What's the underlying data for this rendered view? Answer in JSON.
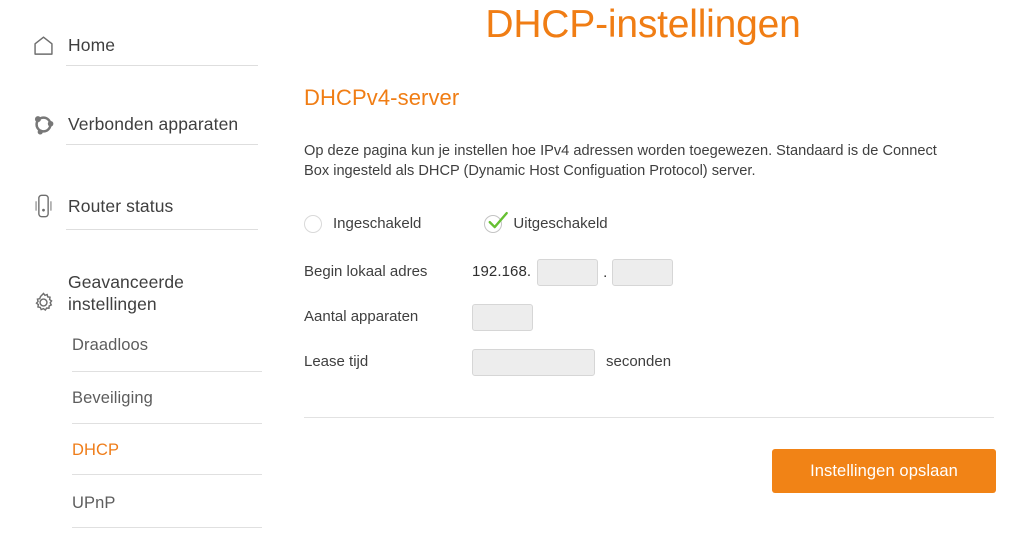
{
  "header": {
    "title": "DHCP-instellingen",
    "accent_color": "#f07d14"
  },
  "sidebar": {
    "main_items": [
      {
        "label": "Home",
        "icon": "home-icon",
        "active": false
      },
      {
        "label": "Verbonden apparaten",
        "icon": "connected-devices-icon",
        "active": false
      },
      {
        "label": "Router status",
        "icon": "router-icon",
        "active": false
      },
      {
        "label": "Geavanceerde instellingen",
        "icon": "gear-icon",
        "active": false
      }
    ],
    "sub_items": [
      {
        "label": "Draadloos",
        "active": false
      },
      {
        "label": "Beveiliging",
        "active": false
      },
      {
        "label": "DHCP",
        "active": true
      },
      {
        "label": "UPnP",
        "active": false
      }
    ],
    "active_color": "#ef7d1a"
  },
  "main": {
    "section_title": "DHCPv4-server",
    "intro_text": "Op deze pagina kun je instellen hoe IPv4 adressen worden toegewezen. Standaard is de Connect Box ingesteld als DHCP (Dynamic Host Configuation Protocol) server.",
    "radio": {
      "options": [
        {
          "label": "Ingeschakeld",
          "selected": false
        },
        {
          "label": "Uitgeschakeld",
          "selected": true
        }
      ],
      "check_color": "#66c032"
    },
    "fields": {
      "start_address": {
        "label": "Begin lokaal adres",
        "prefix": "192.168.",
        "octet3_value": "",
        "octet3_placeholder": "",
        "separator": ".",
        "octet4_value": "",
        "octet4_placeholder": ""
      },
      "device_count": {
        "label": "Aantal apparaten",
        "value": "",
        "placeholder": ""
      },
      "lease_time": {
        "label": "Lease tijd",
        "value": "",
        "placeholder": "",
        "suffix": "seconden"
      }
    },
    "save_button_label": "Instellingen opslaan",
    "button_color": "#f18316"
  }
}
